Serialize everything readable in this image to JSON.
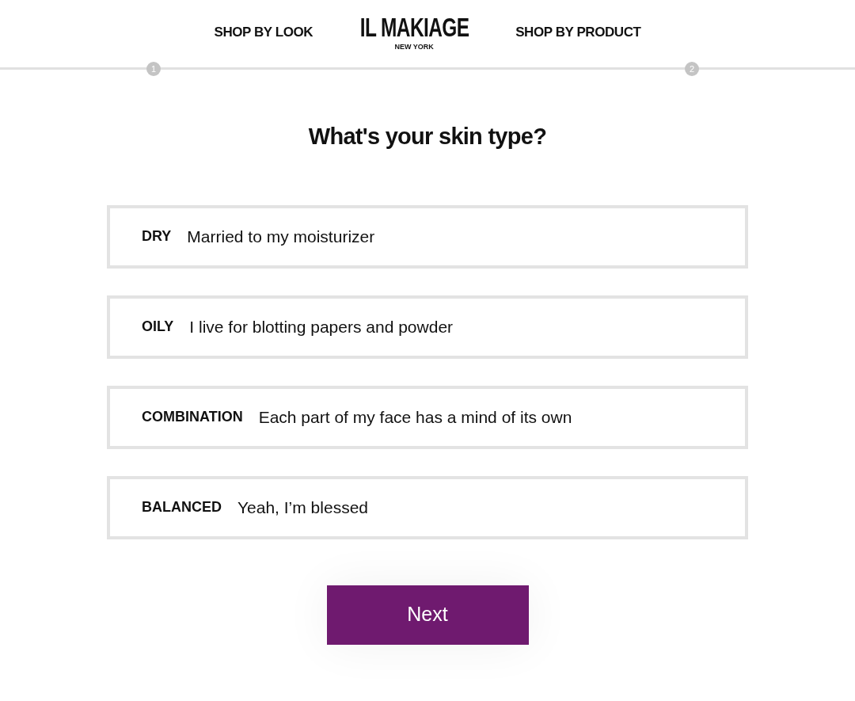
{
  "header": {
    "nav_left": "SHOP BY LOOK",
    "logo": "IL MAKIAGE",
    "logo_sub": "NEW YORK",
    "nav_right": "SHOP BY PRODUCT"
  },
  "steps": [
    "1",
    "2"
  ],
  "question": "What's your skin type?",
  "options": [
    {
      "label": "DRY",
      "description": "Married to my moisturizer",
      "selected": false
    },
    {
      "label": "OILY",
      "description": "I live for blotting papers and powder",
      "selected": false
    },
    {
      "label": "COMBINATION",
      "description": "Each part of my face has a mind of its own",
      "selected": false
    },
    {
      "label": "BALANCED",
      "description": "Yeah, I’m blessed",
      "selected": false
    }
  ],
  "next_button": "Next"
}
